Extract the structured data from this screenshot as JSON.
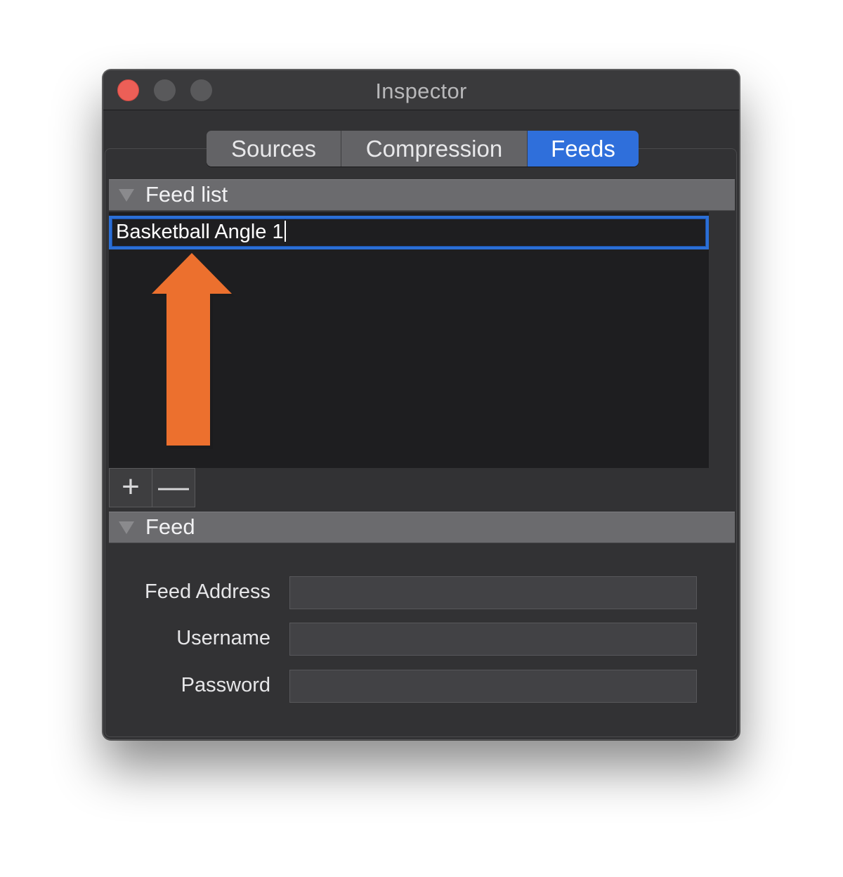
{
  "window": {
    "title": "Inspector",
    "traffic_lights": {
      "close_color": "#ec5f57",
      "minimize_color": "#59595b",
      "zoom_color": "#59595b"
    }
  },
  "tabs": [
    {
      "label": "Sources",
      "selected": false
    },
    {
      "label": "Compression",
      "selected": false
    },
    {
      "label": "Feeds",
      "selected": true
    }
  ],
  "accent_color": "#2f6fdb",
  "feed_list": {
    "header": "Feed list",
    "items": [
      {
        "label": "Basketball Angle 1",
        "editing": true
      }
    ],
    "add_button": "+",
    "remove_button": "—"
  },
  "annotation": {
    "icon": "up-arrow-icon",
    "color": "#ec702e"
  },
  "feed": {
    "header": "Feed",
    "fields": {
      "address": {
        "label": "Feed Address",
        "value": "",
        "placeholder": ""
      },
      "username": {
        "label": "Username",
        "value": "",
        "placeholder": ""
      },
      "password": {
        "label": "Password",
        "value": "",
        "placeholder": ""
      }
    }
  }
}
